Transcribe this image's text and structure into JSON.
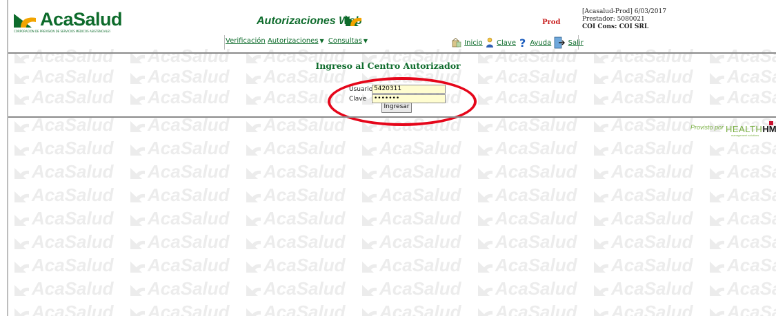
{
  "brand": {
    "name": "AcaSalud",
    "tagline": "CORPORACIÓN DE PREVISIÓN DE SERVICIOS MÉDICOS ASISTENCIALES LIMITADA",
    "color": "#0d6b2b",
    "logo_icon": "acasalud-logo-icon"
  },
  "header": {
    "app_title": "Autorizaciones Web",
    "environment": "Prod",
    "session_line": "[Acasalud-Prod] 6/03/2017",
    "prestador_line": "Prestador: 5080021",
    "coi_line": "COI Cons: COI SRL"
  },
  "menu": {
    "verificacion": "Verificación",
    "autorizaciones": "Autorizaciones",
    "consultas": "Consultas",
    "inicio": "Inicio",
    "clave": "Clave",
    "ayuda": "Ayuda",
    "salir": "Salir"
  },
  "login": {
    "title": "Ingreso al Centro Autorizador",
    "usuario_label": "Usuario",
    "usuario_value": "5420311",
    "clave_label": "Clave",
    "clave_value": "•••••••",
    "submit_label": "Ingresar"
  },
  "footer": {
    "provisto_por": "Provisto por",
    "vendor_health": "HEALTH",
    "vendor_hms": "HMS",
    "vendor_sub": "management solutions"
  },
  "watermark": {
    "text": "AcaSalud"
  },
  "colors": {
    "accent_green": "#0d6b2b",
    "env_red": "#c81e1e",
    "field_bg": "#fffdd0",
    "annotation_red": "#e5061a",
    "hms_green": "#7ab043"
  }
}
